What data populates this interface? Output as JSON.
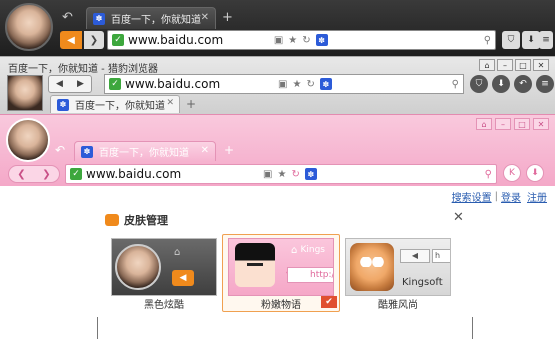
{
  "browser_dark": {
    "tab_title": "百度一下，你就知道",
    "url": "www.baidu.com"
  },
  "browser_gray": {
    "window_title": "百度一下，你就知道 - 猎豹浏览器",
    "tab_title": "百度一下，你就知道",
    "url": "www.baidu.com"
  },
  "browser_pink": {
    "tab_title": "百度一下，你就知道",
    "url": "www.baidu.com"
  },
  "page": {
    "top_links": [
      "搜索设置",
      "登录",
      "注册"
    ]
  },
  "skin_dialog": {
    "title": "皮肤管理",
    "skins": [
      {
        "label": "黑色炫酷"
      },
      {
        "label": "粉嫩物语",
        "preview_text": "Kings",
        "preview_url": "http:/",
        "selected": true
      },
      {
        "label": "酷雅风尚",
        "preview_text": "Kingsoft"
      }
    ]
  },
  "colors": {
    "dark_skin": "#2a2a2a",
    "gray_skin": "#d8d8d8",
    "pink_skin": "#f6b4d0",
    "accent_orange": "#f08a1c",
    "secure_green": "#3da73d",
    "link_blue": "#2a5db0"
  }
}
